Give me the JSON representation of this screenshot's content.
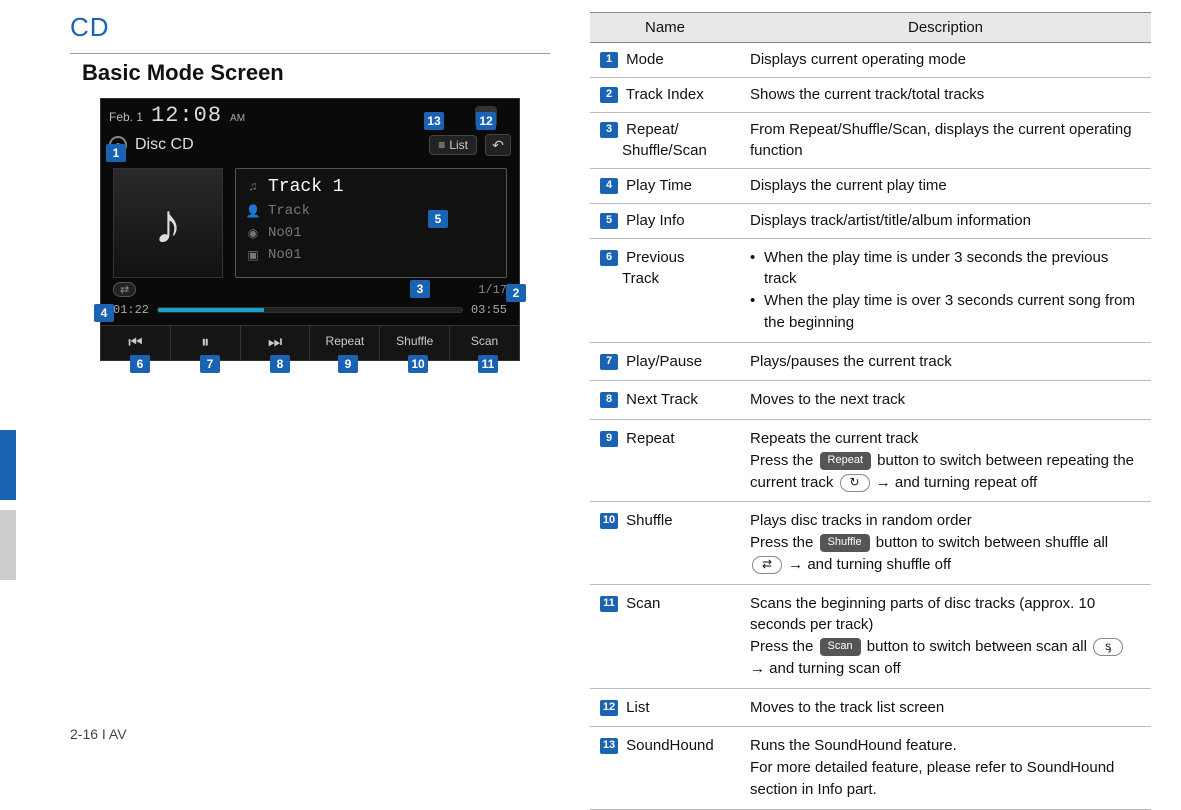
{
  "header": {
    "title": "CD",
    "section": "Basic Mode Screen"
  },
  "footer": {
    "text": "2-16 I AV"
  },
  "screen": {
    "date": "Feb.  1",
    "time": "12:08",
    "ampm": "AM",
    "mode": "Disc CD",
    "list_btn": "List",
    "track_title": "Track 1",
    "track_sub": "Track",
    "no_a": "No01",
    "no_b": "No01",
    "index": "1/17",
    "elapsed": "01:22",
    "total": "03:55",
    "controls": {
      "prev": "",
      "play": "",
      "next": "",
      "repeat": "Repeat",
      "shuffle": "Shuffle",
      "scan": "Scan"
    }
  },
  "callouts": {
    "c1": "1",
    "c2": "2",
    "c3": "3",
    "c4": "4",
    "c5": "5",
    "c6": "6",
    "c7": "7",
    "c8": "8",
    "c9": "9",
    "c10": "10",
    "c11": "11",
    "c12": "12",
    "c13": "13"
  },
  "table": {
    "head_name": "Name",
    "head_desc": "Description",
    "rows": [
      {
        "n": "1",
        "name": "Mode",
        "desc": "Displays current operating mode"
      },
      {
        "n": "2",
        "name": "Track Index",
        "desc": "Shows the current track/total tracks"
      },
      {
        "n": "3",
        "name": "Repeat/ Shuffle/Scan",
        "desc": "From Repeat/Shuffle/Scan, displays the current operating function"
      },
      {
        "n": "4",
        "name": "Play Time",
        "desc": "Displays the current play time"
      },
      {
        "n": "5",
        "name": "Play Info",
        "desc": "Displays track/artist/title/album information"
      },
      {
        "n": "6",
        "name": "Previous Track",
        "desc_bullets": [
          "When the play time is under 3 seconds the previous track",
          "When the play time is over 3 seconds current song from the beginning"
        ]
      },
      {
        "n": "7",
        "name": "Play/Pause",
        "desc": "Plays/pauses the current track"
      },
      {
        "n": "8",
        "name": "Next Track",
        "desc": "Moves to the next track"
      },
      {
        "n": "9",
        "name": "Repeat",
        "desc_rich": {
          "line1": "Repeats the current track",
          "press": "Press the ",
          "chip": "Repeat",
          "after_chip": " button to switch between repeating the current track ",
          "icon": "↻",
          "tail": " → and turning repeat off"
        }
      },
      {
        "n": "10",
        "name": "Shuffle",
        "desc_rich": {
          "line1": "Plays disc tracks in random order",
          "press": "Press the ",
          "chip": "Shuffle",
          "after_chip": " button to switch between shuffle all  ",
          "icon": "⇄",
          "tail": " →  and turning shuffle off"
        }
      },
      {
        "n": "11",
        "name": "Scan",
        "desc_rich": {
          "line1": "Scans the beginning parts of disc tracks (approx. 10 seconds per track)",
          "press": "Press the ",
          "chip": "Scan",
          "after_chip": " button to switch between scan all  ",
          "icon": "ᶊ",
          "tail": " → and turning scan off"
        }
      },
      {
        "n": "12",
        "name": "List",
        "desc": "Moves to the track list screen"
      },
      {
        "n": "13",
        "name": "SoundHound",
        "desc": "Runs the SoundHound feature.\nFor more detailed feature, please refer to SoundHound section in Info part."
      }
    ]
  }
}
